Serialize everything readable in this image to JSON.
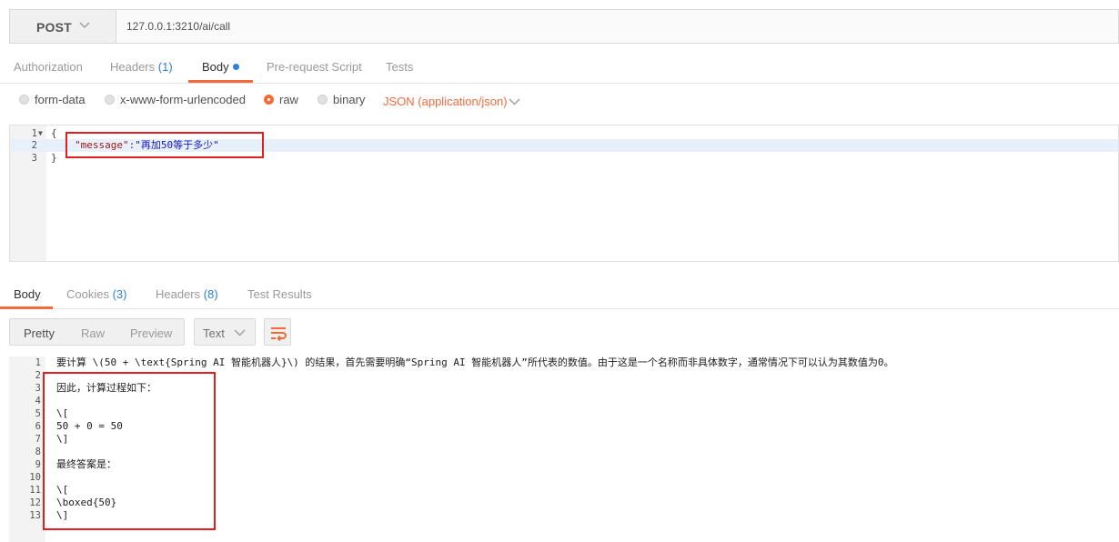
{
  "request": {
    "method": "POST",
    "url": "127.0.0.1:3210/ai/call"
  },
  "request_tabs": [
    {
      "label": "Authorization",
      "count": ""
    },
    {
      "label": "Headers",
      "count": "(1)"
    },
    {
      "label": "Body",
      "count": ""
    },
    {
      "label": "Pre-request Script",
      "count": ""
    },
    {
      "label": "Tests",
      "count": ""
    }
  ],
  "body_types": {
    "form_data": "form-data",
    "urlencoded": "x-www-form-urlencoded",
    "raw": "raw",
    "binary": "binary",
    "content_type": "JSON (application/json)"
  },
  "request_body": {
    "line_numbers": [
      "1",
      "2",
      "3"
    ],
    "open_brace": "{",
    "key": "\"message\"",
    "colon": ":",
    "value": "\"再加50等于多少\"",
    "close_brace": "}"
  },
  "response_tabs": [
    {
      "label": "Body",
      "count": ""
    },
    {
      "label": "Cookies",
      "count": "(3)"
    },
    {
      "label": "Headers",
      "count": "(8)"
    },
    {
      "label": "Test Results",
      "count": ""
    }
  ],
  "response_toolbar": {
    "pretty": "Pretty",
    "raw": "Raw",
    "preview": "Preview",
    "format": "Text"
  },
  "response_lines": [
    {
      "n": "1",
      "text": "要计算 \\(50 + \\text{Spring AI 智能机器人}\\) 的结果，首先需要明确“Spring AI 智能机器人”所代表的数值。由于这是一个名称而非具体数字，通常情况下可以认为其数值为0。"
    },
    {
      "n": "2",
      "text": ""
    },
    {
      "n": "3",
      "text": "因此，计算过程如下："
    },
    {
      "n": "4",
      "text": ""
    },
    {
      "n": "5",
      "text": "\\["
    },
    {
      "n": "6",
      "text": "50 + 0 = 50"
    },
    {
      "n": "7",
      "text": "\\]"
    },
    {
      "n": "8",
      "text": ""
    },
    {
      "n": "9",
      "text": "最终答案是："
    },
    {
      "n": "10",
      "text": ""
    },
    {
      "n": "11",
      "text": "\\["
    },
    {
      "n": "12",
      "text": "\\boxed{50}"
    },
    {
      "n": "13",
      "text": "\\]"
    }
  ],
  "colors": {
    "accent": "#f26b3a",
    "link": "#2e81d6",
    "annotation": "#e02020"
  }
}
